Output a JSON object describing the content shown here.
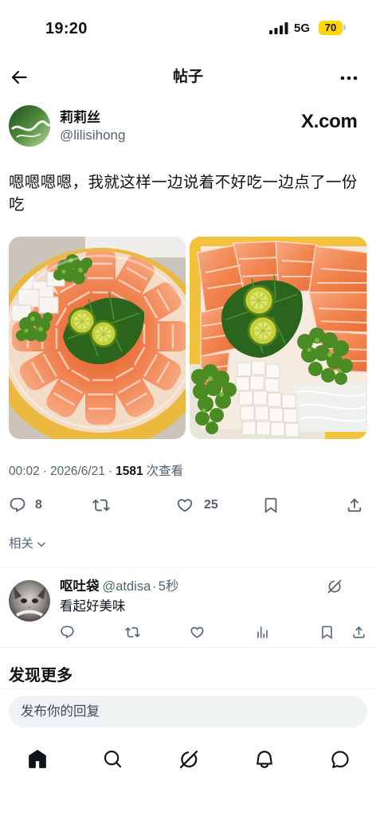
{
  "status_bar": {
    "time": "19:20",
    "network": "5G",
    "battery": "70"
  },
  "header": {
    "title": "帖子"
  },
  "post": {
    "author": {
      "name": "莉莉丝",
      "handle": "@lilisihong"
    },
    "source_badge": "X.com",
    "text": "嗯嗯嗯嗯，我就这样一边说着不好吃一边点了一份吃",
    "meta": {
      "time": "00:02",
      "date": "2026/6/21",
      "views": "1581",
      "views_label": "次查看",
      "separator": "·"
    },
    "stats": {
      "replies": "8",
      "likes": "25"
    },
    "related_label": "相关"
  },
  "reply": {
    "name": "呕吐袋",
    "handle": "@atdisa",
    "separator": "·",
    "time": "5秒",
    "text": "看起好美味"
  },
  "discover": {
    "title": "发现更多"
  },
  "composer": {
    "placeholder": "发布你的回复"
  },
  "icons": {
    "header": [
      "arrow-left-icon",
      "more-dots-icon"
    ],
    "post_actions": [
      "reply-icon",
      "repost-icon",
      "like-icon",
      "bookmark-icon",
      "share-icon"
    ],
    "reply_actions": [
      "reply-icon",
      "repost-icon",
      "like-icon",
      "views-icon",
      "bookmark-icon",
      "share-icon"
    ],
    "bottom_nav": [
      "home-icon",
      "search-icon",
      "grok-icon",
      "notifications-icon",
      "messages-icon"
    ]
  },
  "colors": {
    "text": "#0f1419",
    "secondary": "#536471",
    "divider": "#eff3f4",
    "battery": "#ffd60a",
    "composer_bg": "#eff3f4"
  }
}
